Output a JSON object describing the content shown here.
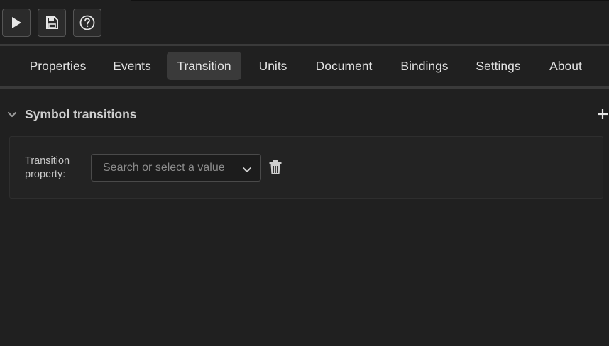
{
  "toolbar": {
    "buttons": [
      {
        "name": "play-button",
        "icon": "play-icon"
      },
      {
        "name": "save-button",
        "icon": "save-icon"
      },
      {
        "name": "help-button",
        "icon": "help-circle-icon"
      }
    ]
  },
  "tabs": [
    {
      "label": "Properties",
      "active": false
    },
    {
      "label": "Events",
      "active": false
    },
    {
      "label": "Transition",
      "active": true
    },
    {
      "label": "Units",
      "active": false
    },
    {
      "label": "Document",
      "active": false
    },
    {
      "label": "Bindings",
      "active": false
    },
    {
      "label": "Settings",
      "active": false
    },
    {
      "label": "About",
      "active": false
    }
  ],
  "section": {
    "title": "Symbol transitions",
    "expanded": true,
    "collapse_icon": "chevron-down-icon",
    "add_icon": "plus-icon"
  },
  "transition": {
    "property_label": "Transition property:",
    "select_placeholder": "Search or select a value",
    "select_value": "",
    "select_icon": "chevron-down-icon",
    "delete_icon": "trash-icon"
  },
  "colors": {
    "background": "#202020",
    "active_tab": "#3a3a3a",
    "text": "#e2e2e2",
    "muted_text": "#8c8c8c",
    "border": "#4a4a4a"
  }
}
